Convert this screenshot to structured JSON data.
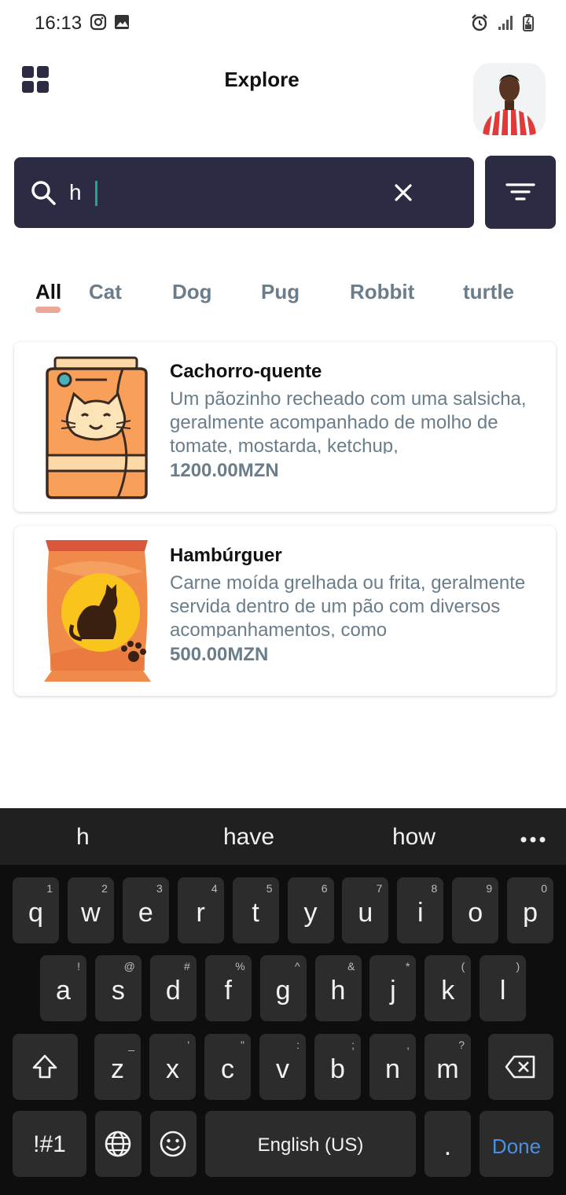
{
  "status_bar": {
    "time": "16:13"
  },
  "header": {
    "title": "Explore"
  },
  "search": {
    "value": "h"
  },
  "tabs": [
    {
      "label": "All"
    },
    {
      "label": "Cat"
    },
    {
      "label": "Dog"
    },
    {
      "label": "Pug"
    },
    {
      "label": "Robbit"
    },
    {
      "label": "turtle"
    }
  ],
  "products": [
    {
      "title": "Cachorro-quente",
      "description": "Um pãozinho recheado com uma salsicha, geralmente acompanhado de molho de tomate, mostarda, ketchup,",
      "price": "1200.00MZN"
    },
    {
      "title": "Hambúrguer",
      "description": "Carne moída grelhada ou frita, geralmente servida dentro de um pão com diversos acompanhamentos, como",
      "price": "500.00MZN"
    }
  ],
  "keyboard": {
    "suggestions": [
      "h",
      "have",
      "how"
    ],
    "row1": [
      {
        "k": "q",
        "h": "1"
      },
      {
        "k": "w",
        "h": "2"
      },
      {
        "k": "e",
        "h": "3"
      },
      {
        "k": "r",
        "h": "4"
      },
      {
        "k": "t",
        "h": "5"
      },
      {
        "k": "y",
        "h": "6"
      },
      {
        "k": "u",
        "h": "7"
      },
      {
        "k": "i",
        "h": "8"
      },
      {
        "k": "o",
        "h": "9"
      },
      {
        "k": "p",
        "h": "0"
      }
    ],
    "row2": [
      {
        "k": "a",
        "h": "!"
      },
      {
        "k": "s",
        "h": "@"
      },
      {
        "k": "d",
        "h": "#"
      },
      {
        "k": "f",
        "h": "%"
      },
      {
        "k": "g",
        "h": "^"
      },
      {
        "k": "h",
        "h": "&"
      },
      {
        "k": "j",
        "h": "*"
      },
      {
        "k": "k",
        "h": "("
      },
      {
        "k": "l",
        "h": ")"
      }
    ],
    "row3": [
      {
        "k": "z",
        "h": "_"
      },
      {
        "k": "x",
        "h": "'"
      },
      {
        "k": "c",
        "h": "\""
      },
      {
        "k": "v",
        "h": ":"
      },
      {
        "k": "b",
        "h": ";"
      },
      {
        "k": "n",
        "h": ","
      },
      {
        "k": "m",
        "h": "?"
      }
    ],
    "symbols_label": "!#1",
    "space_label": "English (US)",
    "period_label": ".",
    "done_label": "Done"
  },
  "colors": {
    "search_bg": "#2b2c43",
    "tab_indicator": "#eaa796",
    "muted_text": "#6a7d8a",
    "done_blue": "#4a90e2"
  }
}
